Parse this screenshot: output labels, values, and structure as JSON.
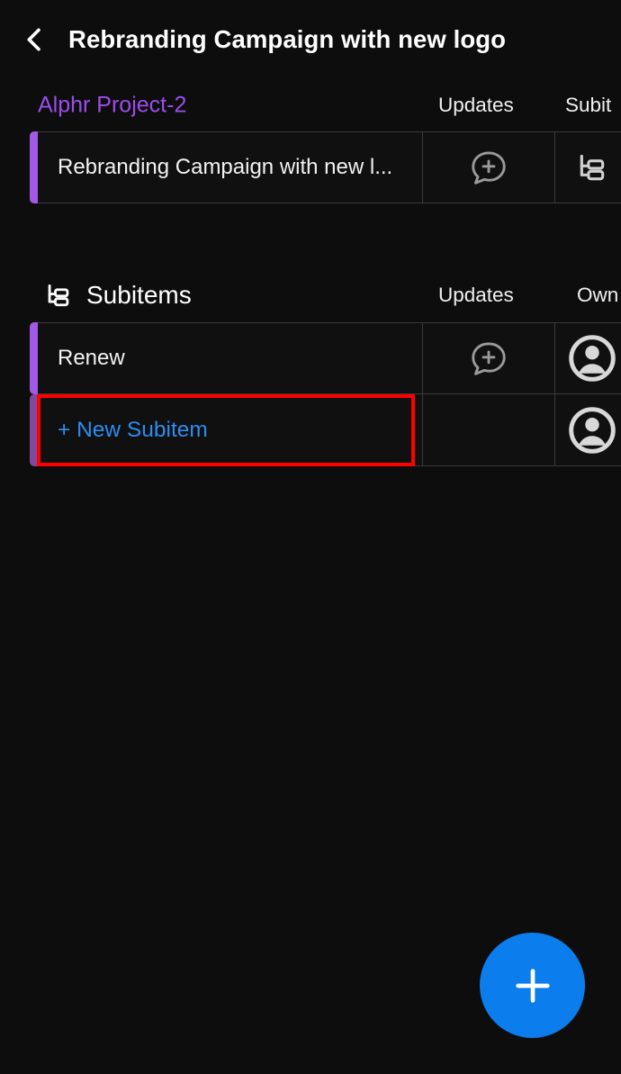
{
  "appbar": {
    "back_icon": "chevron-left-icon",
    "title": "Rebranding Campaign with new logo"
  },
  "board": {
    "name": "Alphr Project-2",
    "columns": [
      "Updates",
      "Subitems"
    ],
    "columns_truncated": [
      "Updates",
      "Subit"
    ],
    "rows": [
      {
        "name": "Rebranding Campaign with new logo",
        "name_truncated": "Rebranding Campaign with new l...",
        "accent": "#a259e6",
        "updates_icon": "chat-plus-icon",
        "subitems_icon": "subitems-tree-icon"
      }
    ]
  },
  "subitems_section": {
    "icon": "subitems-tree-icon",
    "title": "Subitems",
    "columns": [
      "Updates",
      "Owner"
    ],
    "columns_truncated": [
      "Updates",
      "Own"
    ],
    "rows": [
      {
        "name": "Renew",
        "accent": "#a259e6",
        "accent_state": "bright",
        "updates_icon": "chat-plus-icon",
        "owner_icon": "person-avatar-icon",
        "highlighted": false
      },
      {
        "name": "+ New Subitem",
        "accent": "#7d4a9e",
        "accent_state": "dim",
        "updates_icon": "",
        "owner_icon": "person-avatar-icon",
        "highlighted": true,
        "highlight_color": "#ff0000"
      }
    ]
  },
  "fab": {
    "icon": "plus-icon",
    "label": "+",
    "color": "#0b7dec"
  },
  "theme": {
    "background": "#0d0d0d",
    "row_background": "#101010",
    "border": "#3a3a3a",
    "accent_purple": "#a259e6",
    "link_blue": "#2d8cf0",
    "board_purple": "#9b4dea"
  }
}
